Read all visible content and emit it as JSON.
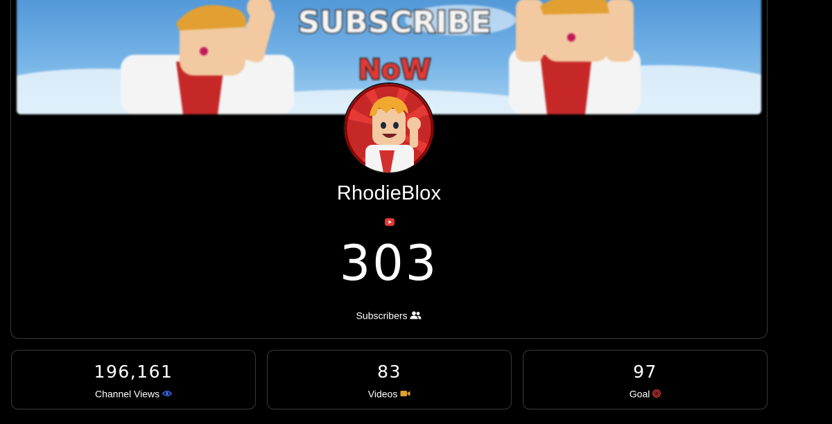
{
  "banner": {
    "headline": "SUBSCRIBE",
    "subline": "NoW"
  },
  "channel": {
    "name": "RhodieBlox",
    "platform_icon": "youtube-icon",
    "subscribers": "303",
    "subscribers_label": "Subscribers",
    "subscribers_icon": "users-icon"
  },
  "stats": [
    {
      "value": "196,161",
      "label": "Channel Views",
      "icon": "eye-icon",
      "icon_color": "#3b6cf6"
    },
    {
      "value": "83",
      "label": "Videos",
      "icon": "video-camera-icon",
      "icon_color": "#e0a030"
    },
    {
      "value": "97",
      "label": "Goal",
      "icon": "target-icon",
      "icon_color": "#e53935"
    }
  ],
  "colors": {
    "background": "#000000",
    "card_border": "#3a3a3c",
    "youtube_red": "#e53935"
  }
}
